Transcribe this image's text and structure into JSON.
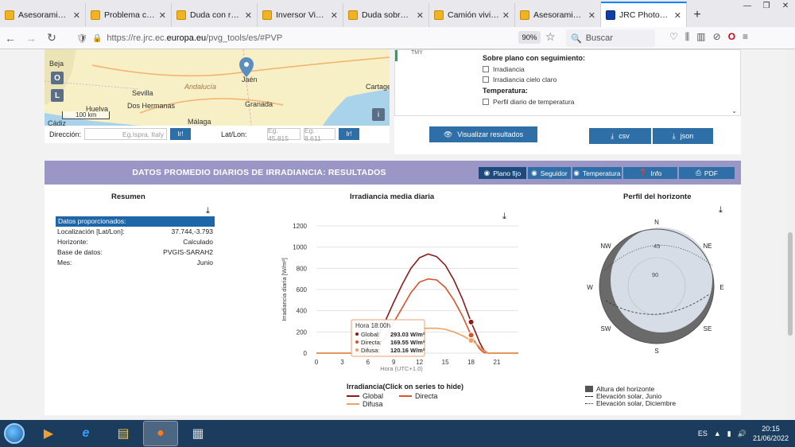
{
  "browser": {
    "tabs": [
      {
        "title": "Asesoramiento s",
        "active": false
      },
      {
        "title": "Problema con di",
        "active": false
      },
      {
        "title": "Duda con resiste",
        "active": false
      },
      {
        "title": "Inversor Victron",
        "active": false
      },
      {
        "title": "Duda sobre ecua",
        "active": false
      },
      {
        "title": "Camión vivienda.",
        "active": false
      },
      {
        "title": "Asesoramiento s",
        "active": false
      },
      {
        "title": "JRC Photovoltaic",
        "active": true
      }
    ],
    "url_prefix": "https://re.jrc.ec.",
    "url_domain": "europa.eu",
    "url_suffix": "/pvg_tools/es/#PVP",
    "zoom": "90%",
    "search_placeholder": "Buscar"
  },
  "map": {
    "places": [
      "Beja",
      "Jaén",
      "Sevilla",
      "Andalucía",
      "Dos Hermanas",
      "Granada",
      "Huelva",
      "Cádiz",
      "Cartagen",
      "Málaga"
    ],
    "scale_label": "100 km",
    "btn_o": "O",
    "btn_l": "L",
    "info": "i"
  },
  "location_form": {
    "direction_label": "Dirección:",
    "direction_placeholder": "Eg.Ispra, Italy",
    "go_label": "Ir!",
    "latlon_label": "Lat/Lon:",
    "lat_placeholder": "Eg. 45.815",
    "lon_placeholder": "Eg. 8.611"
  },
  "options": {
    "tmy_label": "TMY",
    "tracking_heading": "Sobre plano con seguimiento:",
    "cb_irradiance": "Irradiancia",
    "cb_clear_sky": "Irradiancia cielo claro",
    "temp_heading": "Temperatura:",
    "cb_temp_profile": "Perfil diario de temperatura"
  },
  "actions": {
    "visualize": "Visualizar resultados",
    "csv": "csv",
    "json": "json"
  },
  "results": {
    "title": "DATOS PROMEDIO DIARIOS DE IRRADIANCIA: RESULTADOS",
    "tabs": [
      "Plano fijo",
      "Seguidor",
      "Temperatura",
      "Info",
      "PDF"
    ]
  },
  "summary": {
    "title": "Resumen",
    "head": "Datos proporcionados:",
    "rows": [
      {
        "label": "Localización [Lat/Lon]:",
        "value": "37.744,-3.793"
      },
      {
        "label": "Horizonte:",
        "value": "Calculado"
      },
      {
        "label": "Base de datos:",
        "value": "PVGIS-SARAH2"
      },
      {
        "label": "Mes:",
        "value": "Junio"
      }
    ]
  },
  "chart_data": {
    "type": "line",
    "title": "Irradiancia media diaria",
    "ylabel": "Irradiancia diaria [W/m²]",
    "xlabel": "Hora (UTC+1.0)",
    "xlim": [
      0,
      23.5
    ],
    "ylim": [
      0,
      1200
    ],
    "x_ticks": [
      0,
      3,
      6,
      9,
      12,
      15,
      18,
      21
    ],
    "y_ticks": [
      0,
      200,
      400,
      600,
      800,
      1000,
      1200
    ],
    "x": [
      0,
      4.5,
      5.5,
      6,
      6.5,
      7,
      8,
      9,
      10,
      11,
      12,
      13,
      14,
      15,
      16,
      17,
      18,
      18.5,
      19,
      19.5,
      20,
      21,
      23.5
    ],
    "series": [
      {
        "name": "Global",
        "color": "#8b1a1a",
        "values": [
          0,
          0,
          0,
          20,
          60,
          130,
          300,
          480,
          650,
          800,
          900,
          935,
          910,
          830,
          690,
          510,
          293,
          200,
          100,
          25,
          0,
          0,
          0
        ]
      },
      {
        "name": "Directa",
        "color": "#d9532b",
        "values": [
          0,
          0,
          0,
          8,
          25,
          55,
          150,
          290,
          430,
          570,
          670,
          700,
          690,
          620,
          500,
          350,
          170,
          100,
          40,
          5,
          0,
          0,
          0
        ]
      },
      {
        "name": "Difusa",
        "color": "#f0a060",
        "values": [
          0,
          0,
          0,
          12,
          35,
          70,
          130,
          170,
          200,
          220,
          230,
          235,
          235,
          225,
          200,
          165,
          120,
          95,
          60,
          20,
          0,
          0,
          0
        ]
      }
    ],
    "tooltip": {
      "title": "Hora 18:00h",
      "rows": [
        {
          "label": "Global:",
          "value": "293.03 W/m²"
        },
        {
          "label": "Directa:",
          "value": "169.55 W/m²"
        },
        {
          "label": "Difusa:",
          "value": "120.16 W/m²"
        }
      ]
    },
    "legend_title": "Irradiancia(Click on series to hide)"
  },
  "horizon": {
    "title": "Perfil del horizonte",
    "directions": [
      "N",
      "NE",
      "E",
      "SE",
      "S",
      "SW",
      "W",
      "NW"
    ],
    "rings": [
      "45",
      "90"
    ],
    "legend": [
      "Altura del horizonte",
      "Elevación solar, Junio",
      "Elevación solar, Diciembre"
    ]
  },
  "taskbar": {
    "lang": "ES",
    "time": "20:15",
    "date": "21/06/2022"
  }
}
